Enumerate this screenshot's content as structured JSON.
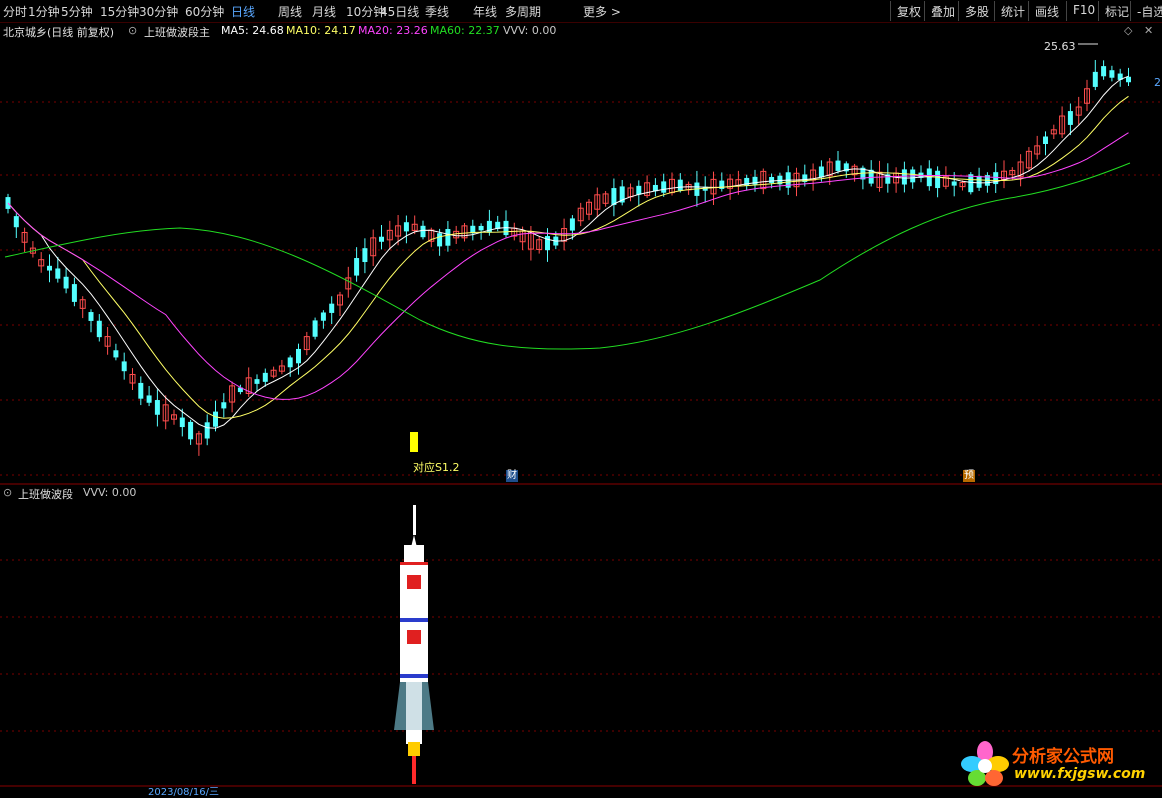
{
  "toolbar": {
    "periods": [
      "分时",
      "1分钟",
      "5分钟",
      "15分钟",
      "30分钟",
      "60分钟",
      "日线",
      "周线",
      "月线",
      "10分钟",
      "45日线",
      "季线",
      "年线",
      "多周期",
      "更多 >"
    ],
    "active": "日线",
    "right_buttons": [
      "复权",
      "叠加",
      "多股",
      "统计",
      "画线",
      "F10",
      "标记",
      "-自选"
    ]
  },
  "main_panel": {
    "stock_label": "北京城乡(日线 前复权)",
    "indicator": "上班做波段主",
    "ma5_label": "MA5: 24.68",
    "ma10_label": "MA10: 24.17",
    "ma20_label": "MA20: 23.26",
    "ma60_label": "MA60: 22.37",
    "vvv_label": "VVV: 0.00",
    "high_marker": "25.63",
    "buy_label": "对应S1.2",
    "badge_cai": "财",
    "badge_yu": "预",
    "right_edge_label": "2"
  },
  "sub_panel": {
    "indicator": "上班做波段",
    "vvv_label": "VVV: 0.00"
  },
  "bottom_axis": {
    "date_label": "2023/08/16/三"
  },
  "watermark": {
    "title": "分析家公式网",
    "url": "www.fxjgsw.com"
  },
  "colors": {
    "up": "#ff4d4d",
    "down": "#54ffff",
    "ma5": "#ffffff",
    "ma10": "#ffff66",
    "ma20": "#ff44ff",
    "ma60": "#22dd22",
    "active_tab": "#5aa8ff",
    "grid": "#7a0000"
  },
  "icons": [
    "settings-circle-icon",
    "diamond-icon",
    "close-icon",
    "flower-logo-icon",
    "rocket-icon"
  ]
}
